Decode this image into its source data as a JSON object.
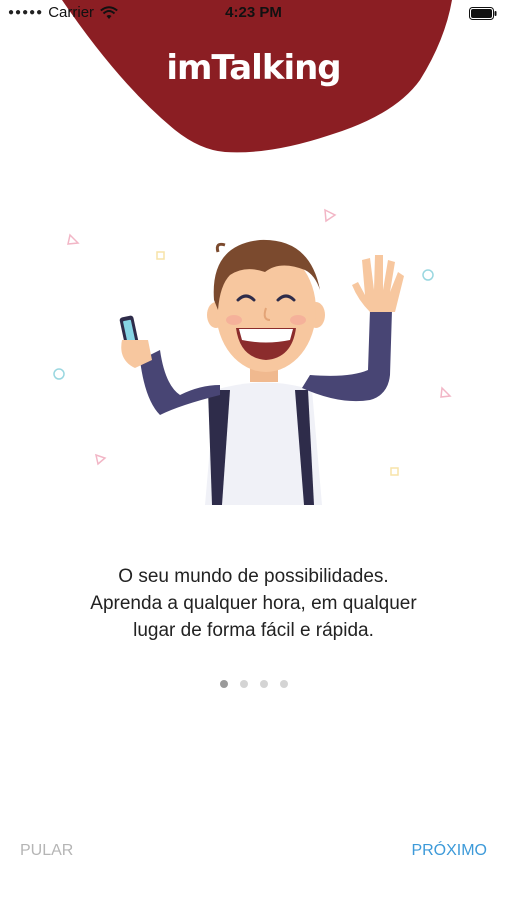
{
  "status_bar": {
    "carrier": "Carrier",
    "time": "4:23 PM"
  },
  "header": {
    "logo_main": "imTalking",
    "brand_color": "#8b1e23",
    "logo_dot_color": "#f0a030"
  },
  "onboarding": {
    "caption_lines": [
      "O seu mundo de possibilidades.",
      "Aprenda a qualquer hora, em qualquer",
      "lugar de forma fácil e rápida."
    ],
    "page_count": 4,
    "active_page": 1
  },
  "footer": {
    "skip_label": "PULAR",
    "next_label": "PRÓXIMO",
    "skip_color": "#b5b5b5",
    "next_color": "#3d9ad9"
  }
}
